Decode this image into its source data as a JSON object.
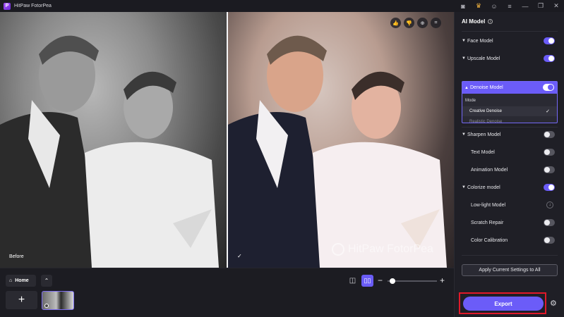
{
  "app": {
    "title": "HitPaw FotorPea",
    "logo_letter": "P"
  },
  "titlebar": {
    "icons": [
      "discord-icon",
      "crown-icon",
      "account-icon",
      "menu-icon",
      "minimize-icon",
      "restore-icon",
      "close-icon"
    ],
    "glyphs": [
      "◙",
      "♛",
      "☺",
      "≡",
      "—",
      "❐",
      "✕"
    ]
  },
  "canvas": {
    "before_label": "Before",
    "after_check": "✓",
    "watermark": "HitPaw FotorPea",
    "tools": [
      {
        "name": "thumbs-up-icon",
        "glyph": "👍"
      },
      {
        "name": "thumbs-down-icon",
        "glyph": "👎"
      },
      {
        "name": "zoom-icon",
        "glyph": "⊕"
      },
      {
        "name": "crop-icon",
        "glyph": "⌗"
      }
    ]
  },
  "bottom": {
    "home_label": "Home",
    "home_glyph": "⌂",
    "collapse_glyph": "⌃",
    "add_glyph": "+",
    "split_glyph": "◫",
    "side_glyph": "▯▯",
    "zoom_minus": "−",
    "zoom_plus": "+",
    "zoom_fraction": 0.1
  },
  "panel": {
    "title": "AI Model",
    "info_glyph": "i",
    "models": [
      {
        "label": "Face Model",
        "caret": "▼",
        "on": true
      },
      {
        "label": "Upscale Model",
        "caret": "▼",
        "on": true
      },
      {
        "label": "Denoise Model",
        "caret": "▲",
        "on": true
      },
      {
        "label": "Sharpen Model",
        "caret": "▼",
        "on": false
      },
      {
        "label": "Text Model",
        "on": false
      },
      {
        "label": "Animation Model",
        "on": false
      },
      {
        "label": "Colorize model",
        "caret": "▼",
        "on": true
      },
      {
        "label": "Low-light Model",
        "download": true
      },
      {
        "label": "Scratch Repair",
        "on": false
      },
      {
        "label": "Color Calibration",
        "on": false
      }
    ],
    "denoise": {
      "mode_label": "Mode",
      "selected": "Creative Denoise",
      "other": "Realistic Denoise",
      "tick": "✓"
    },
    "download_glyph": "↓",
    "apply_label": "Apply Current Settings to All",
    "export_label": "Export",
    "gear_glyph": "⚙",
    "accent": "#6b5cf8",
    "highlight": "#e0192a"
  }
}
